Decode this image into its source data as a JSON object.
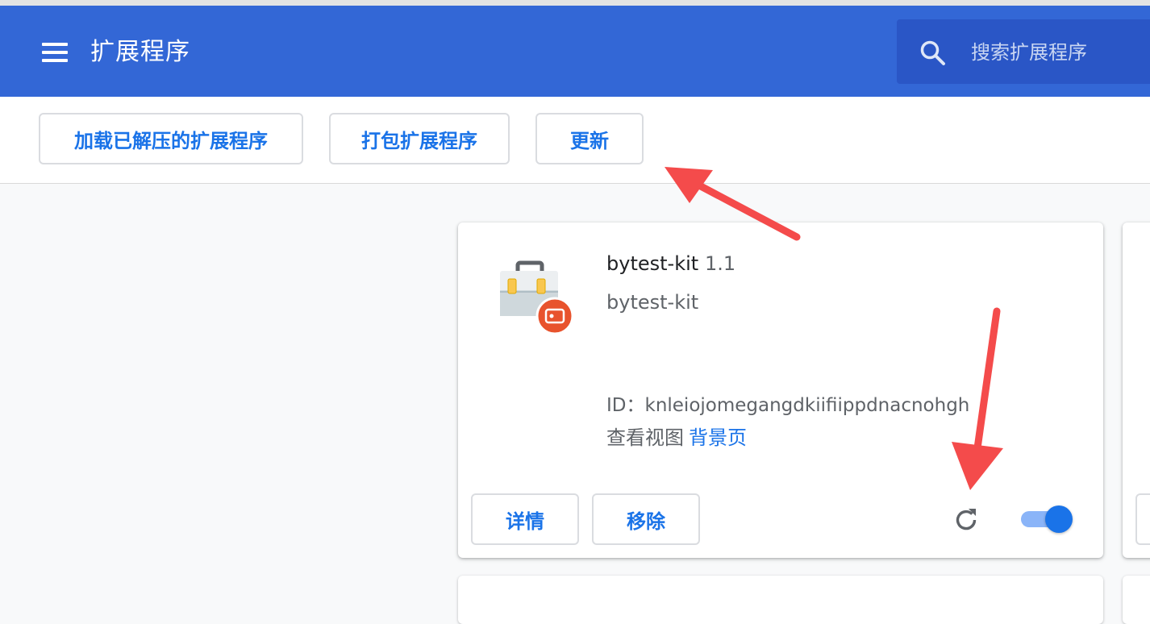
{
  "header": {
    "title": "扩展程序",
    "search_placeholder": "搜索扩展程序",
    "menu_icon": "hamburger-menu-icon",
    "search_icon": "search-icon"
  },
  "toolbar": {
    "load_unpacked_label": "加载已解压的扩展程序",
    "pack_label": "打包扩展程序",
    "update_label": "更新"
  },
  "extension": {
    "name": "bytest-kit",
    "version": "1.1",
    "description": "bytest-kit",
    "id_label": "ID：",
    "id_value": "knleiojomegangdkiifiippdnacnohgh",
    "views_label": "查看视图",
    "views_link": "背景页",
    "details_label": "详情",
    "remove_label": "移除",
    "enabled": true,
    "icon": "toolbox-icon",
    "badge_icon": "record-badge-icon"
  },
  "colors": {
    "header_bg": "#3367d6",
    "accent": "#1a73e8",
    "annotation_arrow": "#f44b4b"
  }
}
